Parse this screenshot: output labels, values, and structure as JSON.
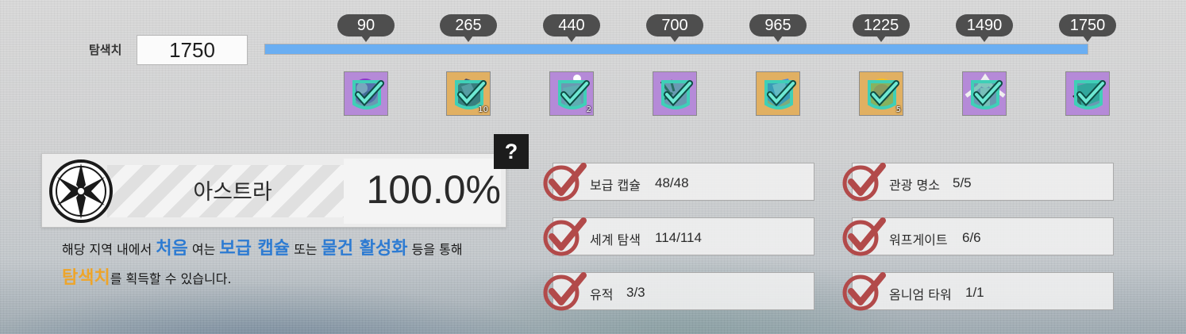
{
  "exploration": {
    "label": "탐색치",
    "value": "1750",
    "fill_fraction": 1.0
  },
  "milestones": [
    {
      "value": "90",
      "reward": {
        "icon": "purple-orb-item-icon",
        "quantity": ""
      },
      "claimed": true,
      "rarity_color": "#b58ad8"
    },
    {
      "value": "265",
      "reward": {
        "icon": "ore-chunk-item-icon",
        "quantity": "10"
      },
      "claimed": true,
      "rarity_color": "#e1b062"
    },
    {
      "value": "440",
      "reward": {
        "icon": "crystal-vial-item-icon",
        "quantity": "2"
      },
      "claimed": true,
      "rarity_color": "#b58ad8"
    },
    {
      "value": "700",
      "reward": {
        "icon": "plant-item-icon",
        "quantity": ""
      },
      "claimed": true,
      "rarity_color": "#b58ad8"
    },
    {
      "value": "965",
      "reward": {
        "icon": "blue-gem-item-icon",
        "quantity": ""
      },
      "claimed": true,
      "rarity_color": "#e1b062"
    },
    {
      "value": "1225",
      "reward": {
        "icon": "gold-coin-item-icon",
        "quantity": "5"
      },
      "claimed": true,
      "rarity_color": "#e1b062"
    },
    {
      "value": "1490",
      "reward": {
        "icon": "character-card-item-icon",
        "quantity": ""
      },
      "claimed": true,
      "rarity_color": "#b58ad8"
    },
    {
      "value": "1750",
      "reward": {
        "icon": "teal-crystal-item-icon",
        "quantity": ""
      },
      "claimed": true,
      "rarity_color": "#b58ad8"
    }
  ],
  "region": {
    "name": "아스트라",
    "percent": "100.0%",
    "emblem": "compass-star-emblem-icon"
  },
  "help_button": {
    "label": "?"
  },
  "description": {
    "line1": {
      "pre": "해당 지역 내에서 ",
      "hl1": "처음",
      "mid1": " 여는 ",
      "hl2": "보급 캡슐",
      "mid2": " 또는 ",
      "hl3": "물건 활성화",
      "post": " 등을 통해"
    },
    "line2": {
      "hl": "탐색치",
      "post": "를 획득할 수 있습니다."
    }
  },
  "stats": [
    {
      "label": "보급 캡슐",
      "count": "48/48",
      "complete": true
    },
    {
      "label": "관광 명소",
      "count": "5/5",
      "complete": true
    },
    {
      "label": "세계 탐색",
      "count": "114/114",
      "complete": true
    },
    {
      "label": "워프게이트",
      "count": "6/6",
      "complete": true
    },
    {
      "label": "유적",
      "count": "3/3",
      "complete": true
    },
    {
      "label": "옴니엄 타워",
      "count": "1/1",
      "complete": true
    }
  ],
  "colors": {
    "bar_fill": "#6aaef2",
    "claimed_check": "#3fcfb7",
    "stat_check": "#b24a4a",
    "highlight_blue": "#2d7bd2",
    "highlight_orange": "#eea52a"
  }
}
